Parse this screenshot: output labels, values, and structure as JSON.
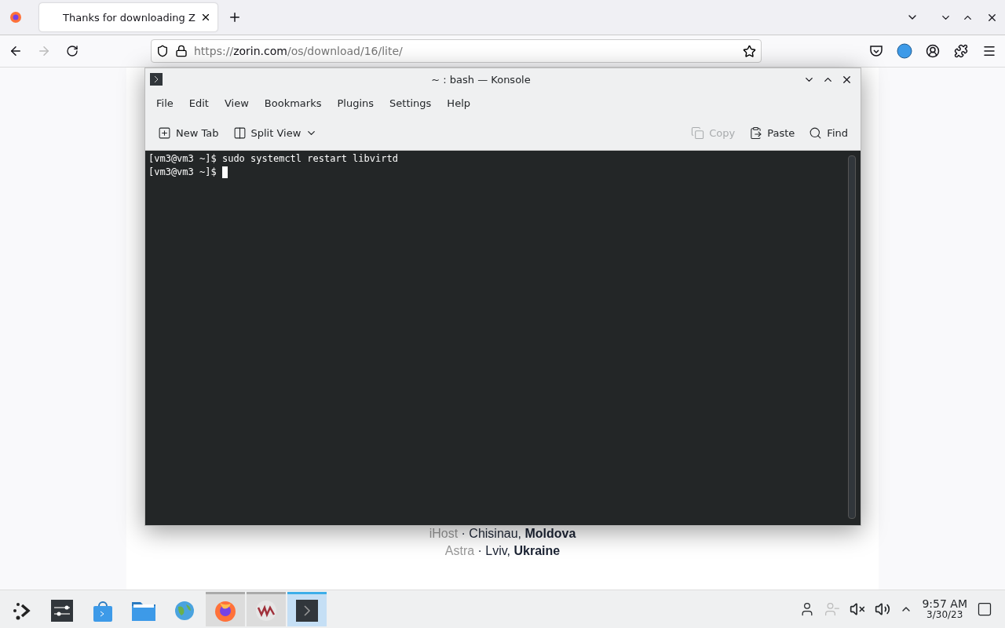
{
  "browser": {
    "tabs": [
      {
        "title": "Thanks for downloading Z",
        "selected": true
      }
    ],
    "url": {
      "scheme": "https://",
      "host": "zorin.com",
      "path": "/os/download/16/lite/"
    },
    "forward_disabled": true
  },
  "page": {
    "mirrors": [
      {
        "provider": "iHost",
        "location": "· Chisinau, **Moldova**"
      },
      {
        "provider": "Astra",
        "location": "· Lviv, **Ukraine**"
      }
    ]
  },
  "konsole": {
    "title": "~ : bash — Konsole",
    "menu": [
      "File",
      "Edit",
      "View",
      "Bookmarks",
      "Plugins",
      "Settings",
      "Help"
    ],
    "toolbar": [
      {
        "kind": "newtab",
        "label": "New Tab",
        "disabled": false
      },
      {
        "kind": "split",
        "label": "Split View",
        "disabled": false
      },
      {
        "kind": "copy",
        "label": "Copy",
        "disabled": true
      },
      {
        "kind": "paste",
        "label": "Paste",
        "disabled": false
      },
      {
        "kind": "find",
        "label": "Find",
        "disabled": false
      }
    ],
    "lines": [
      {
        "prompt": "[vm3@vm3 ~]$",
        "command": "sudo systemctl restart libvirtd",
        "cursor": false
      },
      {
        "prompt": "[vm3@vm3 ~]$",
        "cursor": true
      }
    ]
  },
  "taskbar": {
    "items": [
      {
        "kind": "launcher",
        "open": false,
        "selected": false
      },
      {
        "kind": "settings",
        "open": false,
        "selected": false
      },
      {
        "kind": "store",
        "open": false,
        "selected": false
      },
      {
        "kind": "files",
        "open": false,
        "selected": false
      },
      {
        "kind": "globe",
        "open": false,
        "selected": false
      },
      {
        "kind": "firefox",
        "open": true,
        "selected": false
      },
      {
        "kind": "vm",
        "open": true,
        "selected": false
      },
      {
        "kind": "terminal",
        "open": true,
        "selected": true
      }
    ],
    "time": "9:57 AM",
    "date": "3/30/23"
  }
}
